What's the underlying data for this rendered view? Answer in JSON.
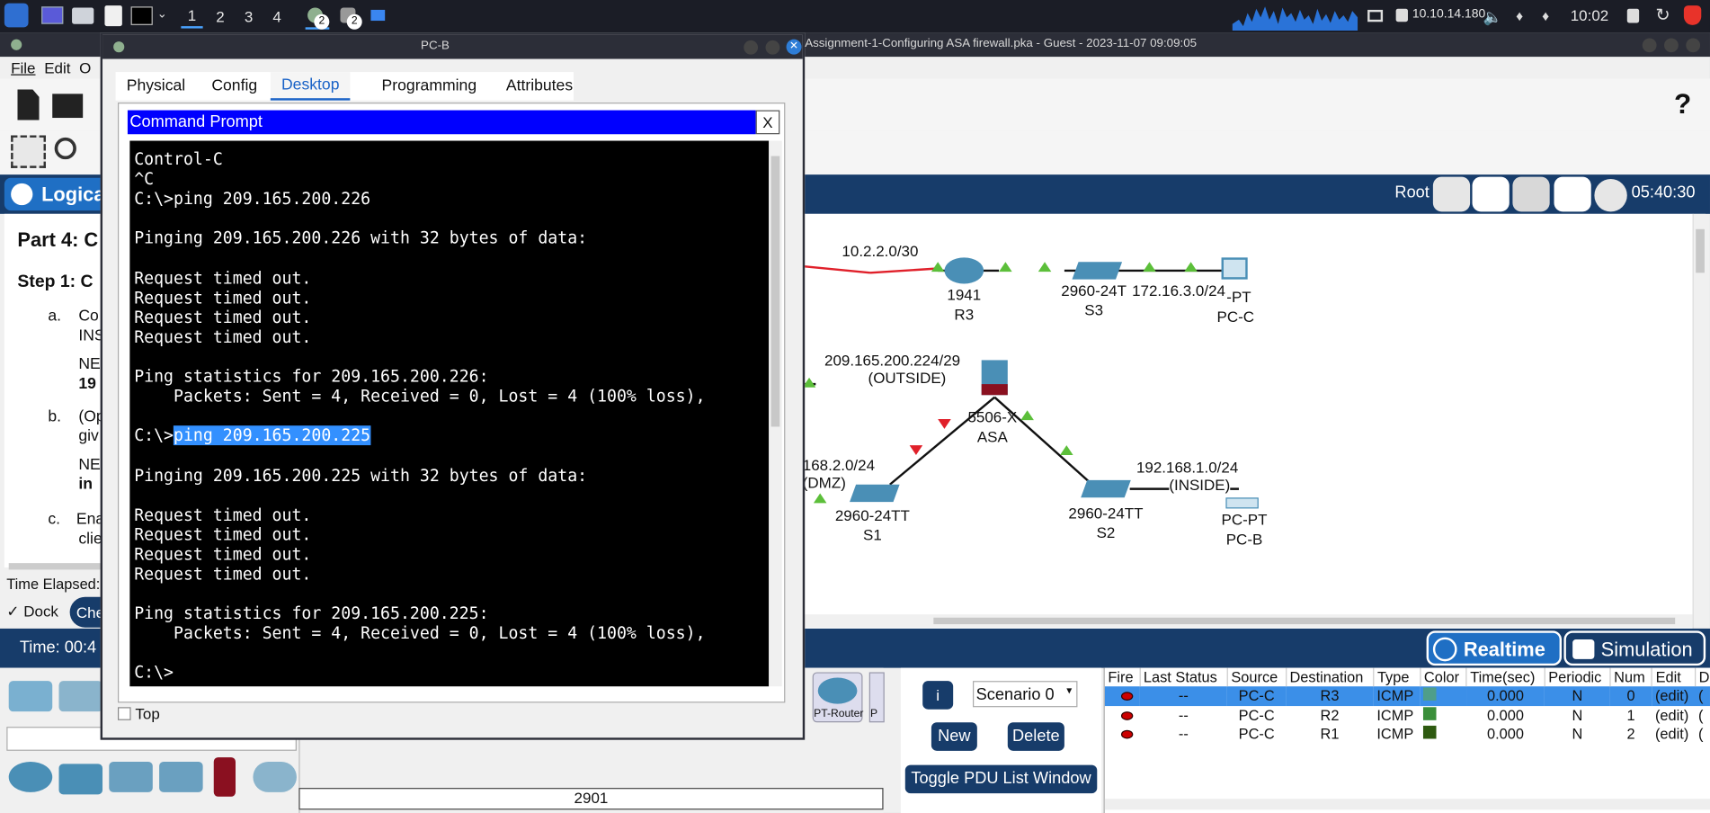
{
  "taskbar": {
    "workspaces": [
      "1",
      "2",
      "3",
      "4"
    ],
    "badge1": "2",
    "badge2": "2",
    "ip": "10.10.14.180",
    "clock": "10:02"
  },
  "main_window": {
    "title": "Assignment-1-Configuring ASA firewall.pka - Guest - 2023-11-07 09:09:05",
    "menu": [
      "File",
      "Edit",
      "O"
    ],
    "logical_tab": "Logical",
    "root_label": "Root",
    "time_display": "05:40:30",
    "instructions": {
      "part": "Part 4: C",
      "step": "Step 1: C",
      "a_marker": "a.",
      "a_line1": "Co",
      "a_line2": "INS",
      "a_ne": "NE",
      "a_val": "19",
      "b_marker": "b.",
      "b_line1": "(Op",
      "b_line2": "giv",
      "b_ne": "NE",
      "b_val": "in",
      "c_marker": "c.",
      "c_line1": "Ena",
      "c_line2": "clie"
    },
    "time_elapsed": "Time Elapsed:",
    "dock_label": "Dock",
    "check_btn": "Che",
    "time_bottom": "Time: 00:4",
    "realtime": "Realtime",
    "simulation": "Simulation",
    "device_search_value": "",
    "device_model": "2901",
    "pt_router": "PT-Router",
    "pt_router2": "P",
    "scenario": "Scenario 0",
    "new_btn": "New",
    "delete_btn": "Delete",
    "toggle_btn": "Toggle PDU List Window"
  },
  "topology": {
    "net_10_2": "10.2.2.0/30",
    "r3_model": "1941",
    "r3_name": "R3",
    "s3_model": "2960-24T",
    "s3_name": "S3",
    "net_172": "172.16.3.0/24",
    "pcc_model": "-PT",
    "pcc_name": "PC-C",
    "outside_net": "209.165.200.224/29",
    "outside_lbl": "(OUTSIDE)",
    "asa_model": "5506-X",
    "asa_name": "ASA",
    "dmz_net": "168.2.0/24",
    "dmz_lbl": "(DMZ)",
    "s1_model": "2960-24TT",
    "s1_name": "S1",
    "inside_net": "192.168.1.0/24",
    "inside_lbl": "(INSIDE)",
    "s2_model": "2960-24TT",
    "s2_name": "S2",
    "pcb_model": "PC-PT",
    "pcb_name": "PC-B"
  },
  "pdu_table": {
    "headers": [
      "Fire",
      "Last Status",
      "Source",
      "Destination",
      "Type",
      "Color",
      "Time(sec)",
      "Periodic",
      "Num",
      "Edit",
      "D"
    ],
    "rows": [
      {
        "status": "--",
        "source": "PC-C",
        "dest": "R3",
        "type": "ICMP",
        "color": "#4f9e8a",
        "time": "0.000",
        "periodic": "N",
        "num": "0",
        "edit": "(edit)",
        "d": "("
      },
      {
        "status": "--",
        "source": "PC-C",
        "dest": "R2",
        "type": "ICMP",
        "color": "#3a8f3a",
        "time": "0.000",
        "periodic": "N",
        "num": "1",
        "edit": "(edit)",
        "d": "("
      },
      {
        "status": "--",
        "source": "PC-C",
        "dest": "R1",
        "type": "ICMP",
        "color": "#2e5a10",
        "time": "0.000",
        "periodic": "N",
        "num": "2",
        "edit": "(edit)",
        "d": "("
      }
    ]
  },
  "pcb_window": {
    "title": "PC-B",
    "tabs": [
      "Physical",
      "Config",
      "Desktop",
      "Programming",
      "Attributes"
    ],
    "active_tab": "Desktop",
    "cmd_title": "Command Prompt",
    "close_x": "X",
    "top_label": "Top",
    "terminal_lines": [
      "Control-C",
      "^C",
      "C:\\>ping 209.165.200.226",
      "",
      "Pinging 209.165.200.226 with 32 bytes of data:",
      "",
      "Request timed out.",
      "Request timed out.",
      "Request timed out.",
      "Request timed out.",
      "",
      "Ping statistics for 209.165.200.226:",
      "    Packets: Sent = 4, Received = 0, Lost = 4 (100% loss),",
      ""
    ],
    "prompt_prefix": "C:\\>",
    "selected_cmd": "ping 209.165.200.225",
    "terminal_lines2": [
      "",
      "Pinging 209.165.200.225 with 32 bytes of data:",
      "",
      "Request timed out.",
      "Request timed out.",
      "Request timed out.",
      "Request timed out.",
      "",
      "Ping statistics for 209.165.200.225:",
      "    Packets: Sent = 4, Received = 0, Lost = 4 (100% loss),",
      "",
      "C:\\>"
    ]
  },
  "colors": {
    "accent": "#1a63c7",
    "cmd_title_bg": "#0000ff",
    "selection": "#3390ff"
  }
}
